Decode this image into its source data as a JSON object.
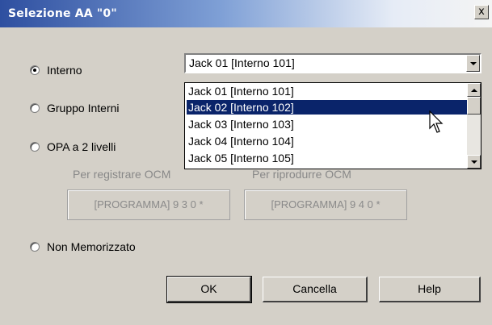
{
  "window": {
    "title": "Selezione AA \"0\"",
    "close_label": "x"
  },
  "radios": [
    {
      "label": "Interno",
      "checked": true
    },
    {
      "label": "Gruppo Interni",
      "checked": false
    },
    {
      "label": "OPA a 2 livelli",
      "checked": false
    },
    {
      "label": "Non Memorizzato",
      "checked": false
    }
  ],
  "combo": {
    "value": "Jack 01 [Interno 101]",
    "options": [
      "Jack 01 [Interno 101]",
      "Jack 02 [Interno 102]",
      "Jack 03 [Interno 103]",
      "Jack 04 [Interno 104]",
      "Jack 05 [Interno 105]"
    ],
    "highlighted": "Jack 02 [Interno 102]"
  },
  "opa": {
    "register_label": "Per registrare OCM",
    "play_label": "Per riprodurre OCM",
    "register_button": "[PROGRAMMA] 9 3 0 *",
    "play_button": "[PROGRAMMA] 9 4 0 *"
  },
  "buttons": {
    "ok": "OK",
    "cancel": "Cancella",
    "help": "Help"
  },
  "colors": {
    "selection": "#0a246a",
    "dialog_bg": "#d4d0c8",
    "title_start": "#2e4fa0"
  }
}
